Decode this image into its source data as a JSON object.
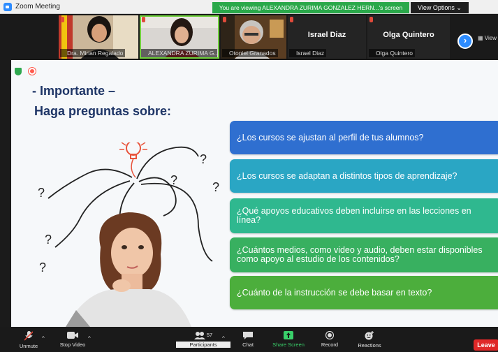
{
  "window": {
    "title": "Zoom Meeting"
  },
  "banner": {
    "text": "You are viewing ALEXANDRA ZURIMA GONZALEZ HERN...'s screen",
    "view_options_label": "View Options ⌄"
  },
  "participants": [
    {
      "name": "Dra. Mirian Regalado",
      "muted": true,
      "video": true,
      "speaking": false
    },
    {
      "name": "ALEXANDRA ZURIMA G...",
      "muted": true,
      "video": true,
      "speaking": true
    },
    {
      "name": "Otoniel Granados",
      "muted": true,
      "video": true,
      "speaking": false
    },
    {
      "name": "Israel Diaz",
      "muted": true,
      "video": false,
      "display_name": "Israel Diaz"
    },
    {
      "name": "Olga Quintero",
      "muted": true,
      "video": false,
      "display_name": "Olga Quintero"
    }
  ],
  "side_view_label": "View",
  "slide": {
    "title": "-  Importante  –",
    "subtitle": "Haga preguntas sobre:",
    "questions": [
      {
        "text": "¿Los cursos se ajustan al perfil de tus alumnos?",
        "color": "#2f6fd0"
      },
      {
        "text": "¿Los cursos se adaptan a distintos tipos de aprendizaje?",
        "color": "#2aa6c4"
      },
      {
        "text": "¿Qué apoyos educativos deben incluirse en las lecciones en línea?",
        "color": "#2fb88f"
      },
      {
        "text": "¿Cuántos medios, como video y audio, deben estar disponibles como apoyo al estudio de los contenidos?",
        "color": "#38b060"
      },
      {
        "text": "¿Cuánto de la instrucción se debe basar en texto?",
        "color": "#4cae3c"
      }
    ]
  },
  "toolbar": {
    "unmute_label": "Unmute",
    "video_label": "Stop Video",
    "participants_count": "57",
    "participants_label": "Participants",
    "chat_label": "Chat",
    "share_label": "Share Screen",
    "record_label": "Record",
    "reactions_label": "Reactions",
    "leave_label": "Leave"
  },
  "colors": {
    "accent": "#2d8cff",
    "banner_green": "#2aa84a",
    "leave_red": "#e02828",
    "slide_title": "#1e3566"
  }
}
